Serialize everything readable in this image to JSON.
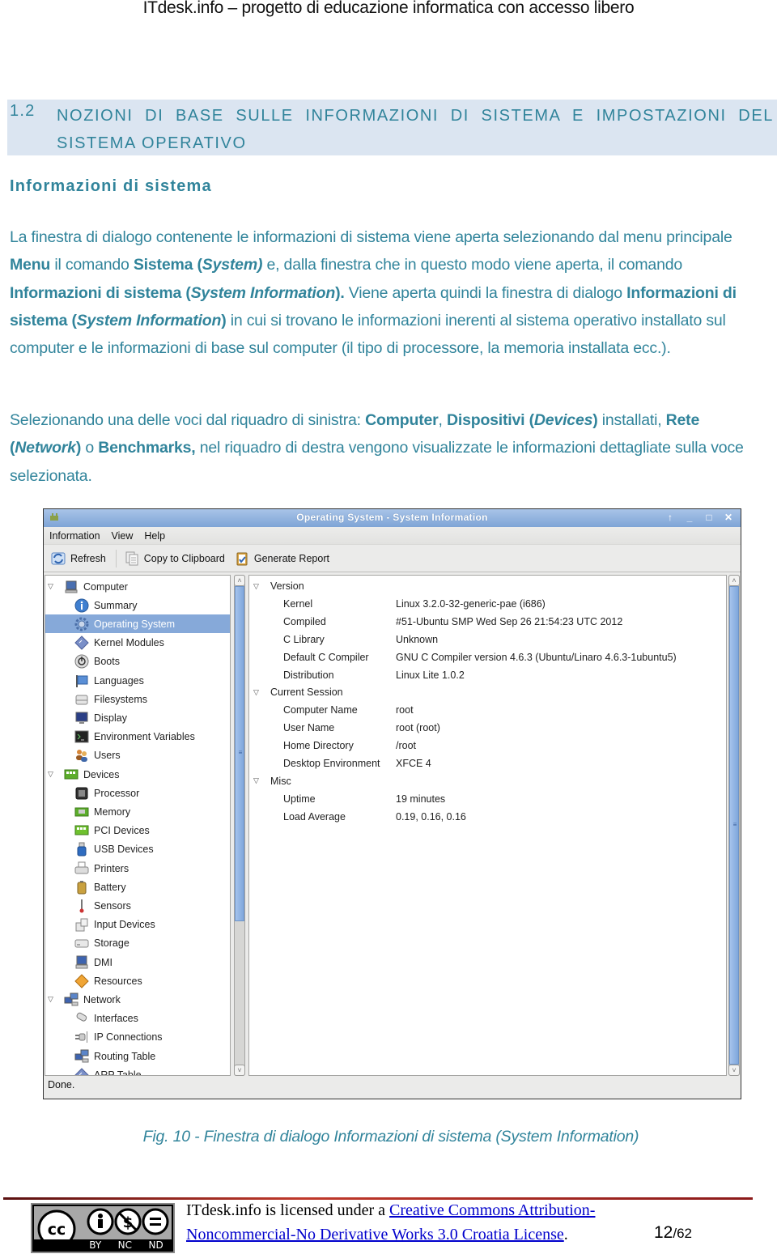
{
  "doc_header": "ITdesk.info – progetto di educazione informatica con accesso libero",
  "section": {
    "number": "1.2",
    "title": "NOZIONI DI BASE SULLE INFORMAZIONI DI SISTEMA E IMPOSTAZIONI DEL SISTEMA OPERATIVO"
  },
  "subheading": "Informazioni di sistema",
  "paragraph1": [
    {
      "t": "La finestra di dialogo contenente le informazioni di sistema viene aperta selezionando dal menu principale ",
      "s": ""
    },
    {
      "t": "Menu",
      "s": "b"
    },
    {
      "t": "  il comando ",
      "s": ""
    },
    {
      "t": "Sistema (",
      "s": "b"
    },
    {
      "t": "System)",
      "s": "bi"
    },
    {
      "t": " e, dalla finestra che in questo modo viene aperta, il comando ",
      "s": ""
    },
    {
      "t": "Informazioni di sistema (",
      "s": "b"
    },
    {
      "t": "System Information",
      "s": "bi"
    },
    {
      "t": ").",
      "s": "b"
    },
    {
      "t": " Viene aperta quindi la finestra di dialogo ",
      "s": ""
    },
    {
      "t": "Informazioni di sistema (",
      "s": "b"
    },
    {
      "t": "System Information",
      "s": "bi"
    },
    {
      "t": ")",
      "s": "b"
    },
    {
      "t": " in cui si trovano le informazioni inerenti al sistema operativo installato sul computer e le informazioni di base sul computer (il tipo di processore, la memoria installata ecc.).",
      "s": ""
    }
  ],
  "paragraph2": [
    {
      "t": "Selezionando una delle voci dal riquadro di sinistra:  ",
      "s": ""
    },
    {
      "t": "Computer",
      "s": "b"
    },
    {
      "t": ", ",
      "s": ""
    },
    {
      "t": "Dispositivi (",
      "s": "b"
    },
    {
      "t": "Devices",
      "s": "bi"
    },
    {
      "t": ")",
      "s": "b"
    },
    {
      "t": " installati, ",
      "s": ""
    },
    {
      "t": "Rete (",
      "s": "b"
    },
    {
      "t": "Network",
      "s": "bi"
    },
    {
      "t": ")",
      "s": "b"
    },
    {
      "t": " o ",
      "s": ""
    },
    {
      "t": "Benchmarks,",
      "s": "b"
    },
    {
      "t": " nel riquadro di destra vengono visualizzate le informazioni dettagliate sulla voce selezionata.",
      "s": ""
    }
  ],
  "window": {
    "title": "Operating System - System Information",
    "title_buttons": [
      "↑",
      "_",
      "□",
      "✕"
    ],
    "menu": [
      "Information",
      "View",
      "Help"
    ],
    "toolbar": {
      "refresh": "Refresh",
      "copy": "Copy to Clipboard",
      "report": "Generate Report"
    },
    "tree": [
      {
        "label": "Computer",
        "level": 0,
        "icon": "computer-icon",
        "expanded": true
      },
      {
        "label": "Summary",
        "level": 1,
        "icon": "info-icon"
      },
      {
        "label": "Operating System",
        "level": 1,
        "icon": "gear-icon",
        "selected": true
      },
      {
        "label": "Kernel Modules",
        "level": 1,
        "icon": "diamond-icon"
      },
      {
        "label": "Boots",
        "level": 1,
        "icon": "power-icon"
      },
      {
        "label": "Languages",
        "level": 1,
        "icon": "flag-icon"
      },
      {
        "label": "Filesystems",
        "level": 1,
        "icon": "drive-icon"
      },
      {
        "label": "Display",
        "level": 1,
        "icon": "monitor-icon"
      },
      {
        "label": "Environment Variables",
        "level": 1,
        "icon": "terminal-icon"
      },
      {
        "label": "Users",
        "level": 1,
        "icon": "users-icon"
      },
      {
        "label": "Devices",
        "level": 0,
        "icon": "board-icon",
        "expanded": true
      },
      {
        "label": "Processor",
        "level": 1,
        "icon": "cpu-icon"
      },
      {
        "label": "Memory",
        "level": 1,
        "icon": "memory-icon"
      },
      {
        "label": "PCI Devices",
        "level": 1,
        "icon": "pci-icon"
      },
      {
        "label": "USB Devices",
        "level": 1,
        "icon": "usb-icon"
      },
      {
        "label": "Printers",
        "level": 1,
        "icon": "printer-icon"
      },
      {
        "label": "Battery",
        "level": 1,
        "icon": "battery-icon"
      },
      {
        "label": "Sensors",
        "level": 1,
        "icon": "thermometer-icon"
      },
      {
        "label": "Input Devices",
        "level": 1,
        "icon": "input-devices-icon"
      },
      {
        "label": "Storage",
        "level": 1,
        "icon": "storage-icon"
      },
      {
        "label": "DMI",
        "level": 1,
        "icon": "dmi-icon"
      },
      {
        "label": "Resources",
        "level": 1,
        "icon": "resources-icon"
      },
      {
        "label": "Network",
        "level": 0,
        "icon": "network-icon",
        "expanded": true
      },
      {
        "label": "Interfaces",
        "level": 1,
        "icon": "interface-icon"
      },
      {
        "label": "IP Connections",
        "level": 1,
        "icon": "plug-icon"
      },
      {
        "label": "Routing Table",
        "level": 1,
        "icon": "network-icon"
      },
      {
        "label": "ARP Table",
        "level": 1,
        "icon": "diamond-icon"
      }
    ],
    "info": [
      {
        "group": "Version",
        "rows": [
          {
            "key": "Kernel",
            "value": "Linux 3.2.0-32-generic-pae (i686)"
          },
          {
            "key": "Compiled",
            "value": "#51-Ubuntu SMP Wed Sep 26 21:54:23 UTC 2012"
          },
          {
            "key": "C Library",
            "value": "Unknown"
          },
          {
            "key": "Default C Compiler",
            "value": "GNU C Compiler version 4.6.3 (Ubuntu/Linaro 4.6.3-1ubuntu5)"
          },
          {
            "key": "Distribution",
            "value": "Linux Lite 1.0.2"
          }
        ]
      },
      {
        "group": "Current Session",
        "rows": [
          {
            "key": "Computer Name",
            "value": "root"
          },
          {
            "key": "User Name",
            "value": "root (root)"
          },
          {
            "key": "Home Directory",
            "value": "/root"
          },
          {
            "key": "Desktop Environment",
            "value": "XFCE 4"
          }
        ]
      },
      {
        "group": "Misc",
        "rows": [
          {
            "key": "Uptime",
            "value": "19 minutes"
          },
          {
            "key": "Load Average",
            "value": "0.19, 0.16, 0.16"
          }
        ]
      }
    ],
    "left_scroll_fraction_visible": 0.7,
    "right_scroll_fraction_visible": 1.0,
    "status": "Done.",
    "colors": {
      "titlebar": "#86a9d9",
      "selection": "#86a9d9",
      "scroll_thumb": "#8fb2e2"
    }
  },
  "caption": "Fig. 10 - Finestra di dialogo Informazioni di sistema (System Information)",
  "footer": {
    "license_prefix": "ITdesk.info is licensed under a ",
    "license_link_1": "Creative Commons Attribution-",
    "license_link_2": "Noncommercial-No Derivative Works 3.0 Croatia License",
    "license_suffix": ".",
    "cc_labels": [
      "BY",
      "NC",
      "ND"
    ],
    "page_current": "12",
    "page_total": "62"
  },
  "colors": {
    "accent_text": "#31849b",
    "section_band": "#dbe5f1",
    "link": "#0000cc"
  }
}
